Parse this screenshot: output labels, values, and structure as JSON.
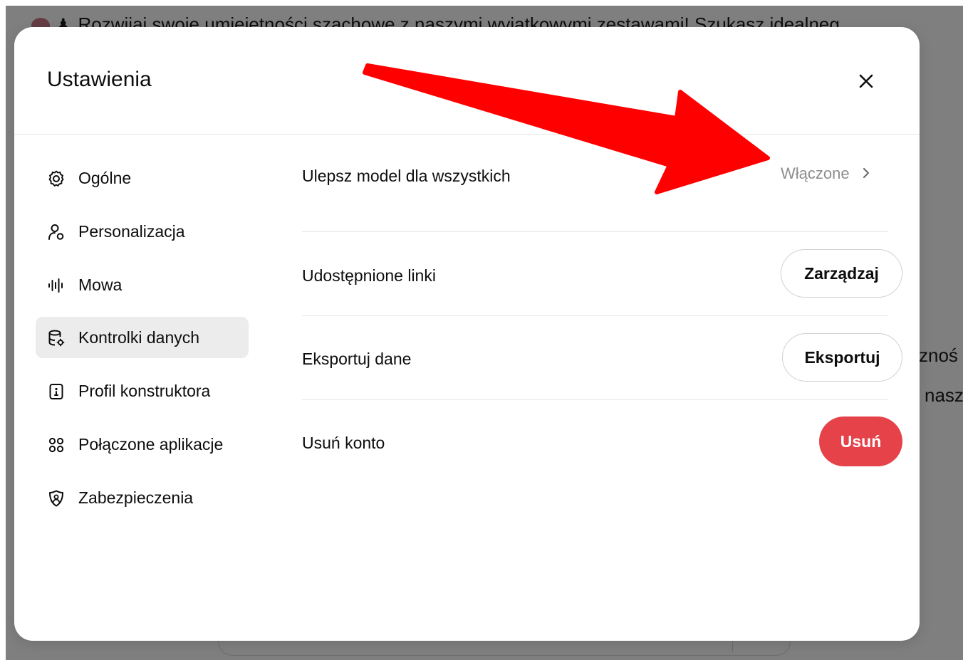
{
  "background": {
    "banner_text": "Rozwijaj swoje umiejętności szachowe z naszymi wyjątkowymi zestawami!",
    "banner_tail": " Szukasz idealneg",
    "side_text_1": "znoś",
    "side_text_2": "nasz"
  },
  "modal": {
    "title": "Ustawienia",
    "close_label": "✕"
  },
  "sidebar": {
    "items": [
      {
        "label": "Ogólne",
        "icon": "gear-icon",
        "active": false
      },
      {
        "label": "Personalizacja",
        "icon": "person-settings-icon",
        "active": false
      },
      {
        "label": "Mowa",
        "icon": "waveform-icon",
        "active": false
      },
      {
        "label": "Kontrolki danych",
        "icon": "database-gear-icon",
        "active": true
      },
      {
        "label": "Profil konstruktora",
        "icon": "id-card-icon",
        "active": false
      },
      {
        "label": "Połączone aplikacje",
        "icon": "apps-grid-icon",
        "active": false
      },
      {
        "label": "Zabezpieczenia",
        "icon": "shield-user-icon",
        "active": false
      }
    ]
  },
  "content": {
    "rows": [
      {
        "label": "Ulepsz model dla wszystkich",
        "value": "Włączone",
        "control": "link"
      },
      {
        "label": "Udostępnione linki",
        "button": "Zarządzaj",
        "control": "button"
      },
      {
        "label": "Eksportuj dane",
        "button": "Eksportuj",
        "control": "button"
      },
      {
        "label": "Usuń konto",
        "button": "Usuń",
        "control": "danger"
      }
    ]
  },
  "colors": {
    "danger": "#e5424a",
    "annotation_arrow": "#ff0000",
    "active_nav_bg": "#ececec",
    "muted_text": "#8e8e8e"
  }
}
